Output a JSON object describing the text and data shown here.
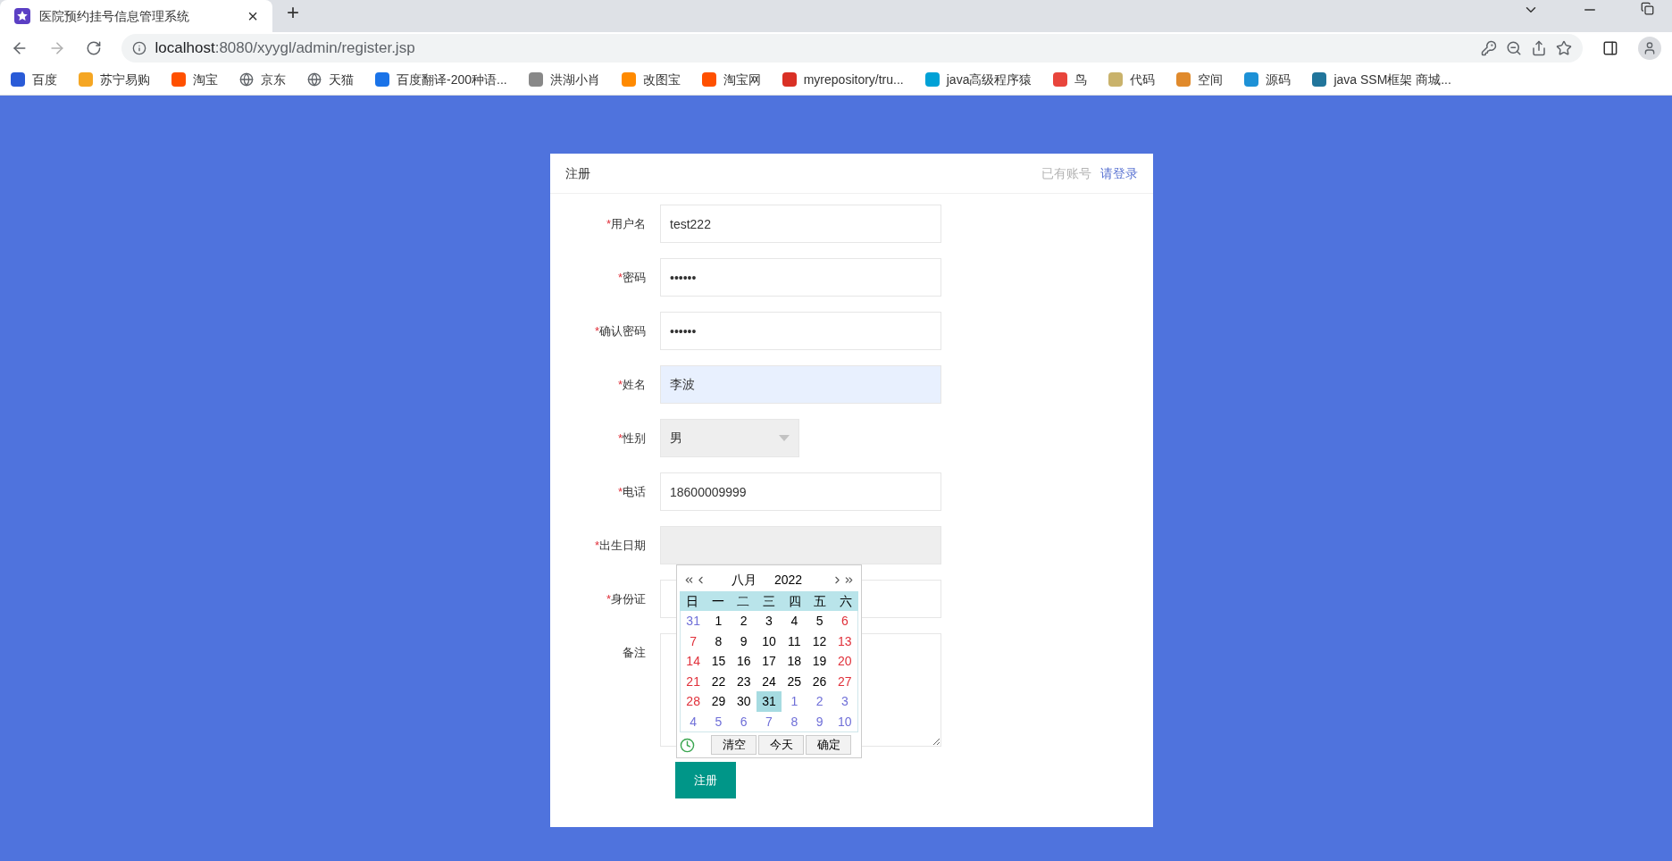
{
  "browser": {
    "tab": {
      "title": "医院预约挂号信息管理系统",
      "close": "×",
      "selected": true
    },
    "new_tab": "+",
    "url_host": "localhost",
    "url_rest": ":8080/xyygl/admin/register.jsp",
    "bookmarks": [
      "百度",
      "苏宁易购",
      "淘宝",
      "京东",
      "天猫",
      "百度翻译-200种语...",
      "洪湖小肖",
      "改图宝",
      "淘宝网",
      "myrepository/tru...",
      "java高级程序猿",
      "鸟",
      "代码",
      "空间",
      "源码",
      "java SSM框架 商城..."
    ]
  },
  "card": {
    "title": "注册",
    "hint": "已有账号",
    "login_link": "请登录"
  },
  "fields": [
    {
      "kind": "text",
      "required_mark": "*",
      "label": "用户名",
      "value": "test222"
    },
    {
      "kind": "password",
      "required_mark": "*",
      "label": "密码",
      "value": "••••••"
    },
    {
      "kind": "password",
      "required_mark": "*",
      "label": "确认密码",
      "value": "••••••"
    },
    {
      "kind": "autofill",
      "required_mark": "*",
      "label": "姓名",
      "value": "李波"
    },
    {
      "kind": "select",
      "required_mark": "*",
      "label": "性别",
      "value": "男"
    },
    {
      "kind": "text",
      "required_mark": "*",
      "label": "电话",
      "value": "18600009999"
    },
    {
      "kind": "date",
      "required_mark": "*",
      "label": "出生日期"
    },
    {
      "kind": "text",
      "required_mark": "*",
      "label": "身份证"
    },
    {
      "kind": "textarea",
      "label": "备注"
    }
  ],
  "submit": "注册",
  "calendar": {
    "month": "八月",
    "year": "2022",
    "weekdays": [
      "日",
      "一",
      "二",
      "三",
      "四",
      "五",
      "六"
    ],
    "weeks": [
      [
        {
          "day": "31",
          "kind": "other",
          "selected": false
        },
        {
          "day": "1",
          "kind": "normal",
          "selected": false
        },
        {
          "day": "2",
          "kind": "normal",
          "selected": false
        },
        {
          "day": "3",
          "kind": "normal",
          "selected": false
        },
        {
          "day": "4",
          "kind": "normal",
          "selected": false
        },
        {
          "day": "5",
          "kind": "normal",
          "selected": false
        },
        {
          "day": "6",
          "kind": "weekend",
          "selected": false
        }
      ],
      [
        {
          "day": "7",
          "kind": "weekend",
          "selected": false
        },
        {
          "day": "8",
          "kind": "normal",
          "selected": false
        },
        {
          "day": "9",
          "kind": "normal",
          "selected": false
        },
        {
          "day": "10",
          "kind": "normal",
          "selected": false
        },
        {
          "day": "11",
          "kind": "normal",
          "selected": false
        },
        {
          "day": "12",
          "kind": "normal",
          "selected": false
        },
        {
          "day": "13",
          "kind": "weekend",
          "selected": false
        }
      ],
      [
        {
          "day": "14",
          "kind": "weekend",
          "selected": false
        },
        {
          "day": "15",
          "kind": "normal",
          "selected": false
        },
        {
          "day": "16",
          "kind": "normal",
          "selected": false
        },
        {
          "day": "17",
          "kind": "normal",
          "selected": false
        },
        {
          "day": "18",
          "kind": "normal",
          "selected": false
        },
        {
          "day": "19",
          "kind": "normal",
          "selected": false
        },
        {
          "day": "20",
          "kind": "weekend",
          "selected": false
        }
      ],
      [
        {
          "day": "21",
          "kind": "weekend",
          "selected": false
        },
        {
          "day": "22",
          "kind": "normal",
          "selected": false
        },
        {
          "day": "23",
          "kind": "normal",
          "selected": false
        },
        {
          "day": "24",
          "kind": "normal",
          "selected": false
        },
        {
          "day": "25",
          "kind": "normal",
          "selected": false
        },
        {
          "day": "26",
          "kind": "normal",
          "selected": false
        },
        {
          "day": "27",
          "kind": "weekend",
          "selected": false
        }
      ],
      [
        {
          "day": "28",
          "kind": "weekend",
          "selected": false
        },
        {
          "day": "29",
          "kind": "normal",
          "selected": false
        },
        {
          "day": "30",
          "kind": "normal",
          "selected": false
        },
        {
          "day": "31",
          "kind": "normal",
          "selected": true
        },
        {
          "day": "1",
          "kind": "other",
          "selected": false
        },
        {
          "day": "2",
          "kind": "other",
          "selected": false
        },
        {
          "day": "3",
          "kind": "other",
          "selected": false
        }
      ],
      [
        {
          "day": "4",
          "kind": "other",
          "selected": false
        },
        {
          "day": "5",
          "kind": "other",
          "selected": false
        },
        {
          "day": "6",
          "kind": "other",
          "selected": false
        },
        {
          "day": "7",
          "kind": "other",
          "selected": false
        },
        {
          "day": "8",
          "kind": "other",
          "selected": false
        },
        {
          "day": "9",
          "kind": "other",
          "selected": false
        },
        {
          "day": "10",
          "kind": "other",
          "selected": false
        }
      ]
    ],
    "buttons": [
      "清空",
      "今天",
      "确定"
    ]
  }
}
